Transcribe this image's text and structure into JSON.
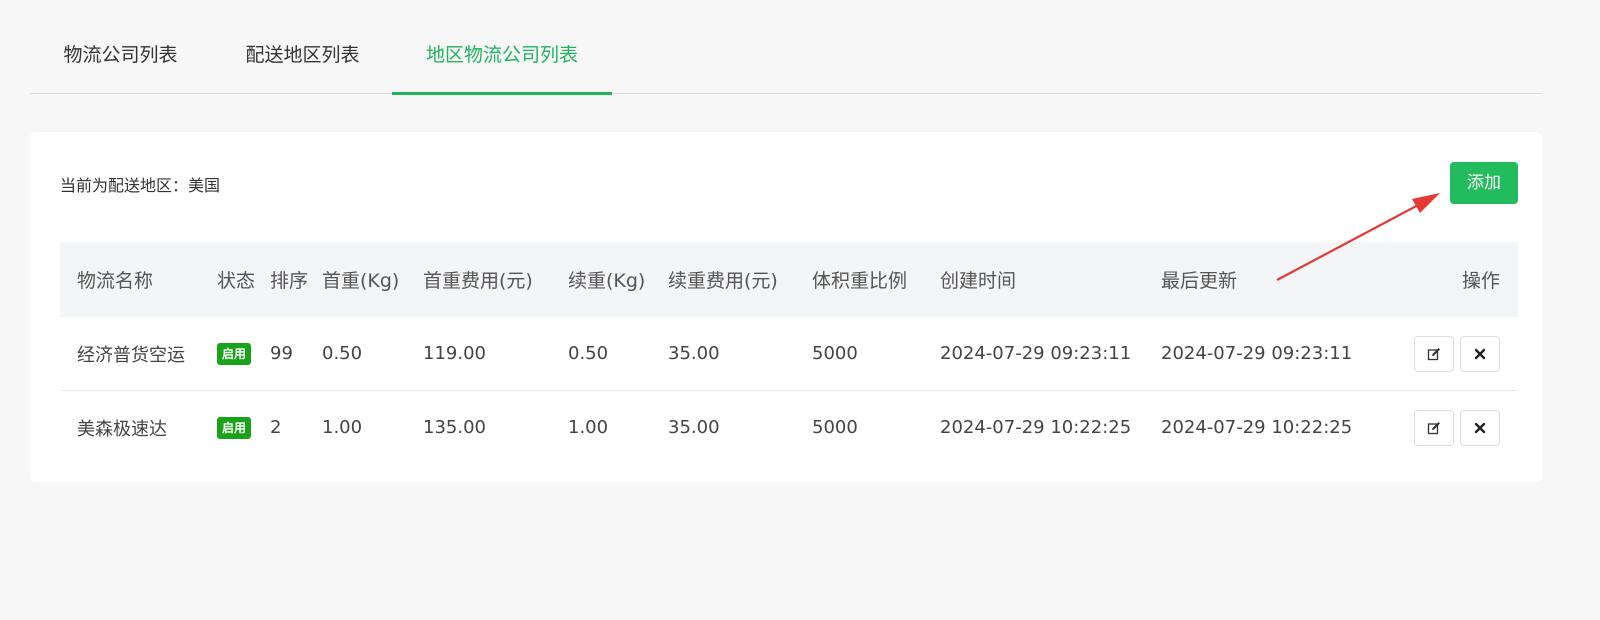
{
  "tabs": [
    {
      "label": "物流公司列表",
      "active": false
    },
    {
      "label": "配送地区列表",
      "active": false
    },
    {
      "label": "地区物流公司列表",
      "active": true
    }
  ],
  "region_label": "当前为配送地区：美国",
  "add_button": "添加",
  "colors": {
    "accent": "#22b35e",
    "add_button": "#22bb5e",
    "badge": "#1aa31a",
    "annotation_arrow": "#e53935"
  },
  "table": {
    "headers": {
      "name": "物流名称",
      "status": "状态",
      "sort": "排序",
      "first_weight": "首重(Kg)",
      "first_fee": "首重费用(元)",
      "cont_weight": "续重(Kg)",
      "cont_fee": "续重费用(元)",
      "vol_ratio": "体积重比例",
      "created": "创建时间",
      "updated": "最后更新",
      "ops": "操作"
    },
    "rows": [
      {
        "name": "经济普货空运",
        "status": "启用",
        "sort": "99",
        "first_weight": "0.50",
        "first_fee": "119.00",
        "cont_weight": "0.50",
        "cont_fee": "35.00",
        "vol_ratio": "5000",
        "created": "2024-07-29 09:23:11",
        "updated": "2024-07-29 09:23:11"
      },
      {
        "name": "美森极速达",
        "status": "启用",
        "sort": "2",
        "first_weight": "1.00",
        "first_fee": "135.00",
        "cont_weight": "1.00",
        "cont_fee": "35.00",
        "vol_ratio": "5000",
        "created": "2024-07-29 10:22:25",
        "updated": "2024-07-29 10:22:25"
      }
    ]
  },
  "icons": {
    "edit": "edit-icon",
    "delete": "close-icon"
  }
}
